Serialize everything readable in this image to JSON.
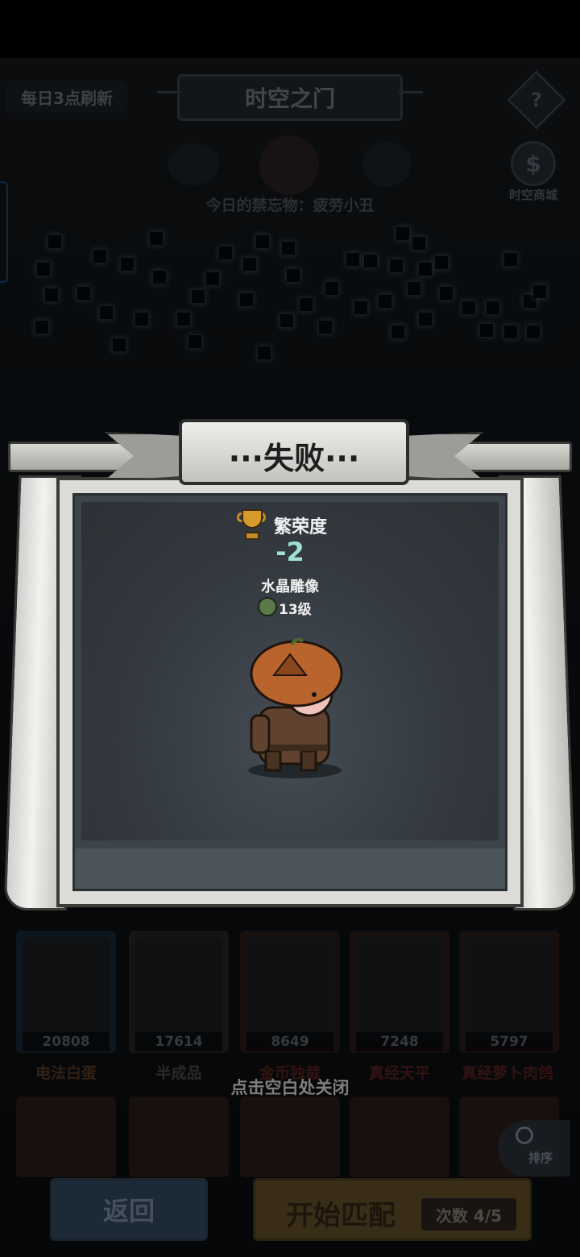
{
  "header": {
    "daily_refresh": "每日3点刷新",
    "title": "时空之门",
    "help_label": "?",
    "shop_icon_glyph": "$",
    "shop_label": "时空商城",
    "forbidden_text": "今日的禁忘物：疲劳小丑"
  },
  "popup": {
    "title": "···失败···",
    "prosperity_label": "繁荣度",
    "prosperity_value": "-2",
    "building_name": "水晶雕像",
    "building_level": "13级"
  },
  "cards": [
    {
      "power": "20808",
      "name": "电法白蛋",
      "name_color": "#5b3c23"
    },
    {
      "power": "17614",
      "name": "半成品",
      "name_color": "#4b4b4b"
    },
    {
      "power": "8649",
      "name": "金币独裁",
      "name_color": "#5b2323"
    },
    {
      "power": "7248",
      "name": "真经天平",
      "name_color": "#5b2323"
    },
    {
      "power": "5797",
      "name": "真经萝卜肉鸽",
      "name_color": "#5b2323"
    }
  ],
  "close_hint": "点击空白处关闭",
  "footer": {
    "sort_label": "排序",
    "back_label": "返回",
    "match_label": "开始匹配",
    "match_count": "次数 4/5"
  },
  "colors": {
    "prosperity_accent": "#9fe0d6",
    "trophy": "#d99a2c"
  }
}
